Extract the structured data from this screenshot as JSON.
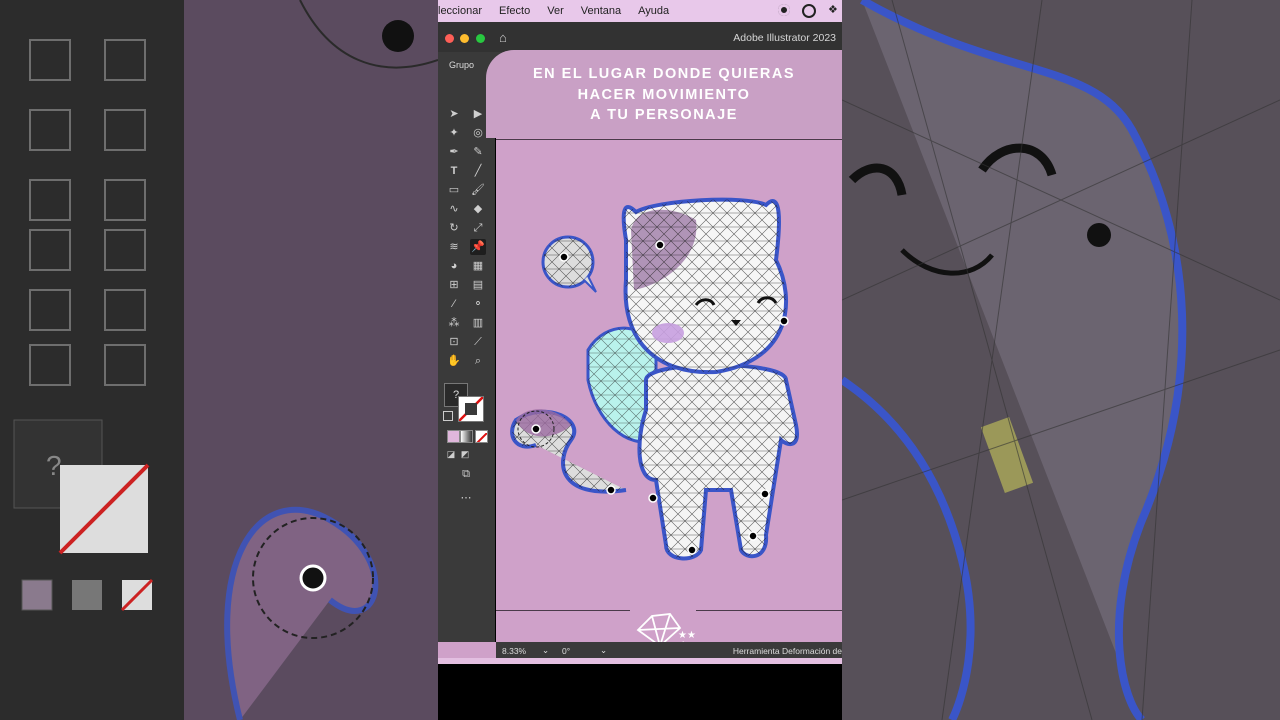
{
  "menubar": {
    "items": [
      "leccionar",
      "Efecto",
      "Ver",
      "Ventana",
      "Ayuda"
    ]
  },
  "window": {
    "app_title": "Adobe Illustrator 2023"
  },
  "control_bar": {
    "label": "Grupo"
  },
  "tutorial": {
    "banner_text": "EN EL LUGAR DONDE QUIERAS HACER MOVIMIENTO A TU PERSONAJE",
    "line1": "EN EL LUGAR DONDE QUIERAS",
    "line2": "HACER MOVIMIENTO",
    "line3": "A TU PERSONAJE"
  },
  "status": {
    "zoom": "8.33%",
    "rotation": "0°",
    "tool_name": "Herramienta Deformación de"
  },
  "colors": {
    "canvas_bg": "#cfa1c9",
    "mesh_blue": "#3a55c8",
    "menubar_bg": "#e8c8ea"
  },
  "fill_stroke": {
    "fill_label": "?"
  }
}
